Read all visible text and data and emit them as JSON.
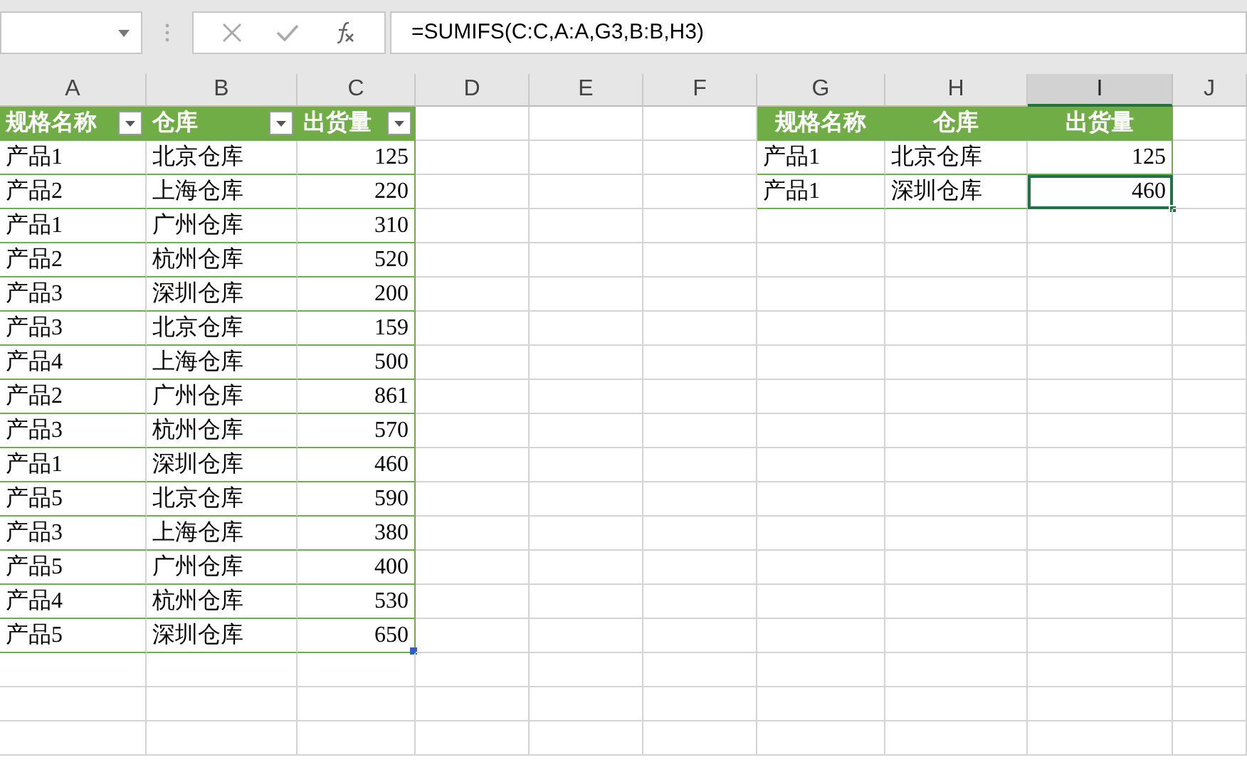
{
  "formula_bar": {
    "formula": "=SUMIFS(C:C,A:A,G3,B:B,H3)"
  },
  "column_headers": [
    {
      "label": "A",
      "selected": false
    },
    {
      "label": "B",
      "selected": false
    },
    {
      "label": "C",
      "selected": false
    },
    {
      "label": "D",
      "selected": false
    },
    {
      "label": "E",
      "selected": false
    },
    {
      "label": "F",
      "selected": false
    },
    {
      "label": "G",
      "selected": false
    },
    {
      "label": "H",
      "selected": false
    },
    {
      "label": "I",
      "selected": true
    },
    {
      "label": "J",
      "selected": false
    }
  ],
  "data_table": {
    "columns": [
      "规格名称",
      "仓库",
      "出货量"
    ],
    "rows": [
      [
        "产品1",
        "北京仓库",
        "125"
      ],
      [
        "产品2",
        "上海仓库",
        "220"
      ],
      [
        "产品1",
        "广州仓库",
        "310"
      ],
      [
        "产品2",
        "杭州仓库",
        "520"
      ],
      [
        "产品3",
        "深圳仓库",
        "200"
      ],
      [
        "产品3",
        "北京仓库",
        "159"
      ],
      [
        "产品4",
        "上海仓库",
        "500"
      ],
      [
        "产品2",
        "广州仓库",
        "861"
      ],
      [
        "产品3",
        "杭州仓库",
        "570"
      ],
      [
        "产品1",
        "深圳仓库",
        "460"
      ],
      [
        "产品5",
        "北京仓库",
        "590"
      ],
      [
        "产品3",
        "上海仓库",
        "380"
      ],
      [
        "产品5",
        "广州仓库",
        "400"
      ],
      [
        "产品4",
        "杭州仓库",
        "530"
      ],
      [
        "产品5",
        "深圳仓库",
        "650"
      ]
    ]
  },
  "lookup_table": {
    "columns": [
      "规格名称",
      "仓库",
      "出货量"
    ],
    "rows": [
      {
        "cells": [
          "产品1",
          "北京仓库",
          "125"
        ],
        "selected": false
      },
      {
        "cells": [
          "产品1",
          "深圳仓库",
          "460"
        ],
        "selected": true
      }
    ]
  }
}
